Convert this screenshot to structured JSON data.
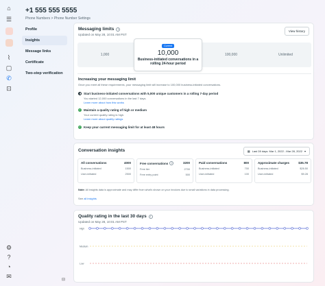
{
  "rail": {
    "icons": [
      "home-icon",
      "menu-icon",
      "app-icon-1",
      "app-icon-2",
      "analytics-icon",
      "chat-icon",
      "phone-icon",
      "cart-icon",
      "settings-icon",
      "help-icon",
      "bell-icon",
      "feedback-icon"
    ]
  },
  "header": {
    "phone": "+1 555 555 5555",
    "breadcrumb_root": "Phone Numbers",
    "breadcrumb_sep": ">",
    "breadcrumb_current": "Phone Number Settings"
  },
  "nav": {
    "items": [
      {
        "label": "Profile",
        "active": false
      },
      {
        "label": "Insights",
        "active": true
      },
      {
        "label": "Message links",
        "active": false
      },
      {
        "label": "Certificate",
        "active": false
      },
      {
        "label": "Two-step verification",
        "active": false
      }
    ]
  },
  "limits": {
    "title": "Messaging limits",
    "updated": "Updated on May 28, 10:01 AM PST",
    "view_history": "View history",
    "tiers": [
      "1,000",
      "10,000",
      "100,000",
      "Unlimited"
    ],
    "current_badge": "Current",
    "current_desc": "Business-initiated conversations in a rolling 24-hour period",
    "increase_title": "Increasing your messaging limit",
    "increase_desc": "Once you meet all these requirements, your messaging limit will increase to 100,000 business-initiated conversations.",
    "steps": [
      {
        "title": "Start business-initiated conversations with 5,000 unique customers in a rolling 7-day period",
        "desc": "You started 12,000 conversations in the last 7 days.",
        "link": "Learn more about how this works",
        "state": "in-progress"
      },
      {
        "title": "Maintain a quality rating of high or medium",
        "desc": "Your current quality rating is high.",
        "link": "Learn more about quality ratings",
        "state": "done"
      },
      {
        "title": "Keep your current messaging limit for at least 48 hours",
        "desc": "",
        "link": "",
        "state": "done"
      }
    ]
  },
  "conversation": {
    "title": "Conversation insights",
    "date_range": "Last 28 days: Mar 1, 2022 - Mar 28, 2022",
    "boxes": [
      {
        "label": "All conversations",
        "value": "4000",
        "rows": [
          {
            "k": "Business-initiated",
            "v": "1500"
          },
          {
            "k": "User-initiated",
            "v": "2500"
          }
        ]
      },
      {
        "label": "Free conversations",
        "value": "3200",
        "rows": [
          {
            "k": "Free tier",
            "v": "2700"
          },
          {
            "k": "Free entry point",
            "v": "500"
          }
        ]
      },
      {
        "label": "Paid conversations",
        "value": "800",
        "rows": [
          {
            "k": "Business-initiated",
            "v": "700"
          },
          {
            "k": "User-initiated",
            "v": "100"
          }
        ]
      },
      {
        "label": "Approximate charges",
        "value": "$35.78",
        "rows": [
          {
            "k": "Business-initiated",
            "v": "$26.50"
          },
          {
            "k": "User-initiated",
            "v": "$9.28"
          }
        ]
      }
    ],
    "note_bold": "Note:",
    "note": "All insights data is approximate and may differ from what's shown on your invoices due to small variations in data processing.",
    "see_prefix": "See",
    "see_link": "all insights"
  },
  "quality": {
    "title": "Quality rating in the last 30 days",
    "updated": "Updated on May 28, 10:01 AM PST"
  },
  "chart_data": {
    "type": "line",
    "title": "Quality rating in the last 30 days",
    "y_categories": [
      "High",
      "Medium",
      "Low"
    ],
    "series": [
      {
        "values": [
          "High",
          "High",
          "High",
          "High",
          "High",
          "High",
          "High",
          "High",
          "High",
          "High",
          "High",
          "High",
          "High",
          "High",
          "High",
          "High",
          "High",
          "High",
          "High",
          "High",
          "High",
          "High",
          "High",
          "High",
          "High",
          "High",
          "High",
          "High",
          "High",
          "High"
        ]
      }
    ],
    "colors": {
      "line": "#5b6fd6",
      "medium": "#e8c64a",
      "low": "#e05c5c"
    }
  }
}
